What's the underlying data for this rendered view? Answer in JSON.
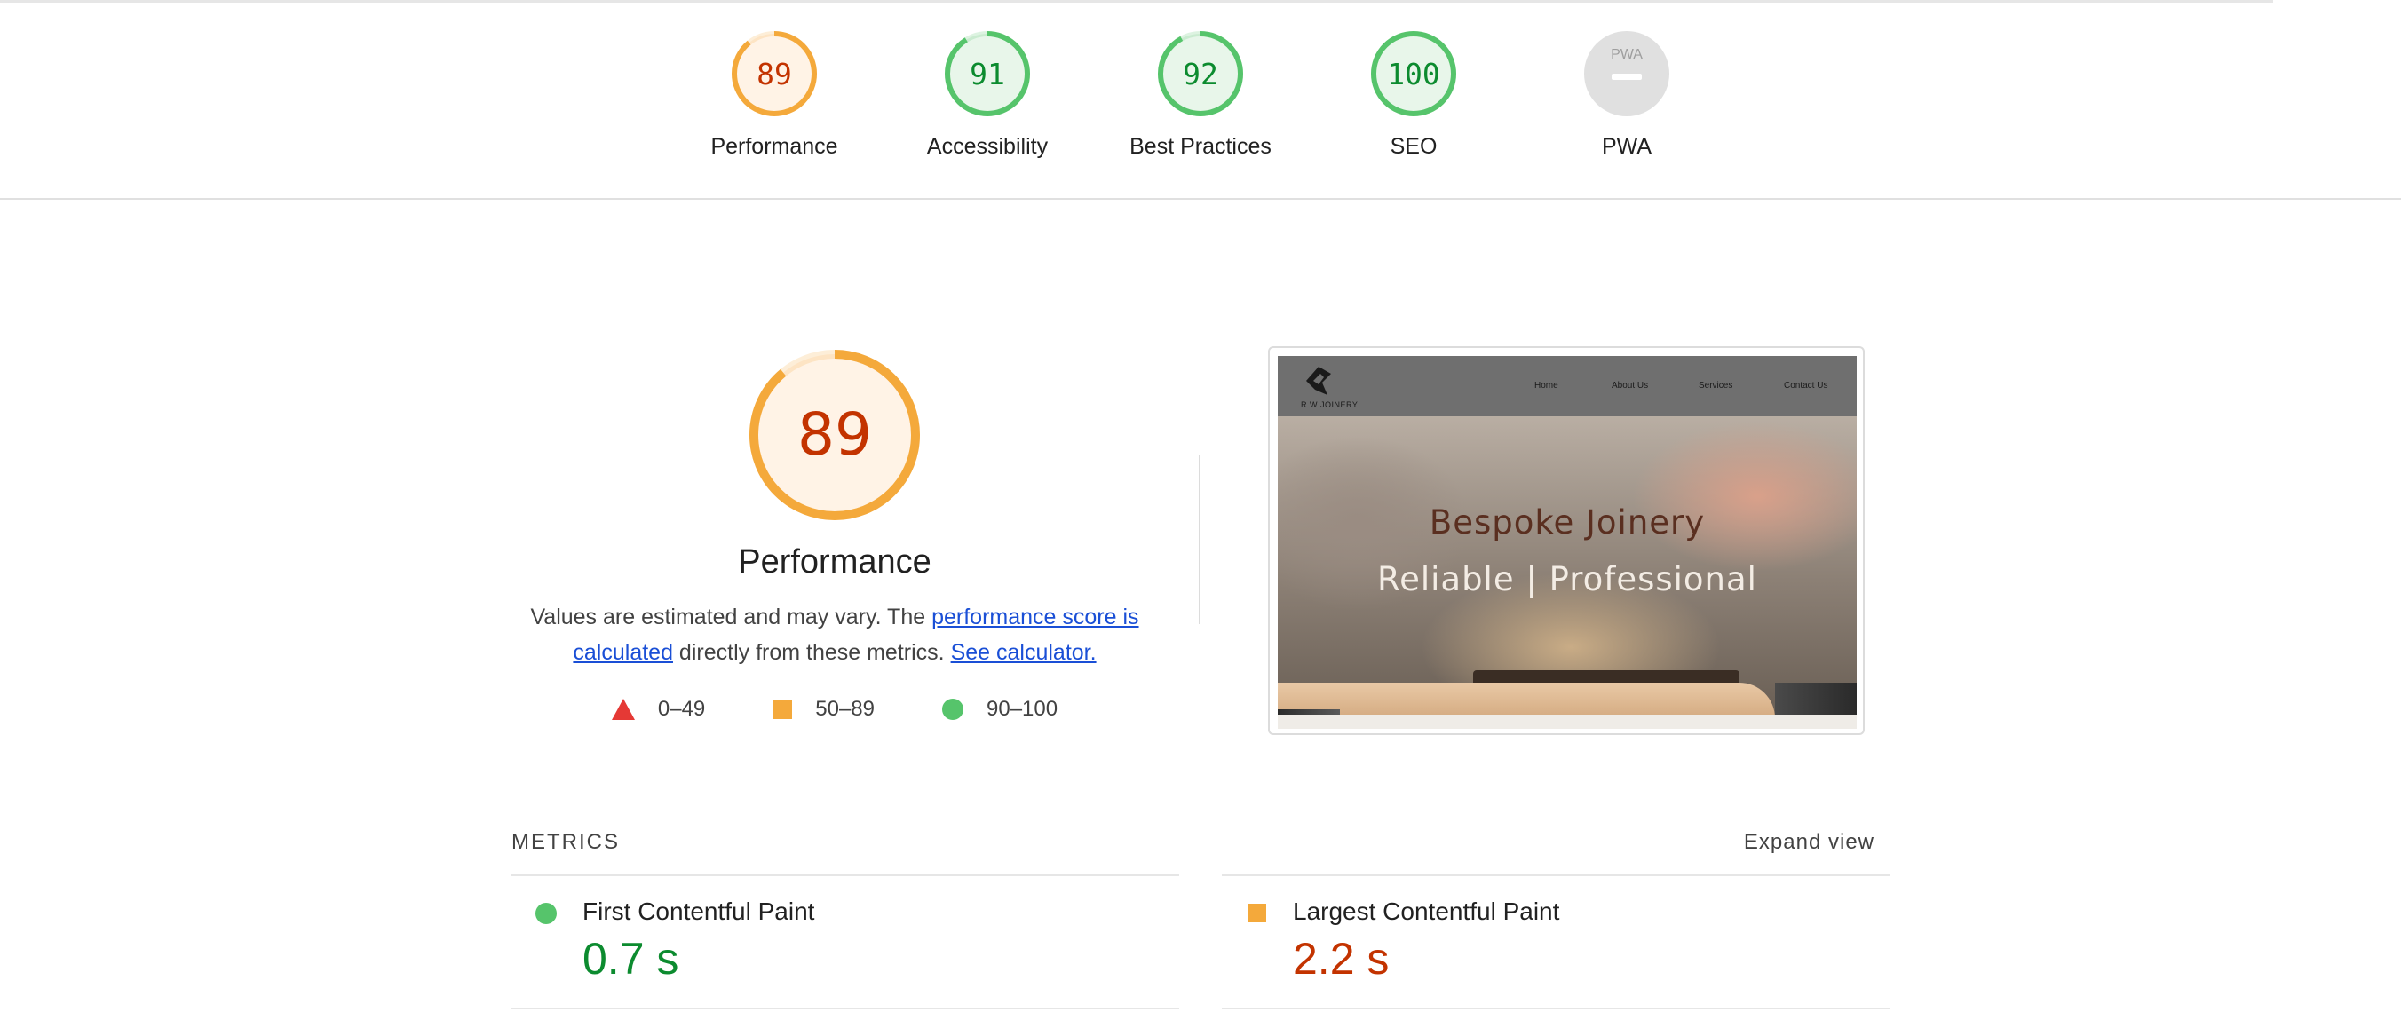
{
  "colors": {
    "pass": "#0c8b2f",
    "average": "#c33300",
    "fail": "#e53935",
    "pass_ring": "#56c46b",
    "average_ring": "#f4a93b",
    "pwa_ring": "#e0e0e0",
    "link": "#1a4fd6"
  },
  "summary": {
    "gauges": [
      {
        "score": "89",
        "label": "Performance",
        "rating": "average",
        "fraction": 0.89
      },
      {
        "score": "91",
        "label": "Accessibility",
        "rating": "pass",
        "fraction": 0.91
      },
      {
        "score": "92",
        "label": "Best Practices",
        "rating": "pass",
        "fraction": 0.92
      },
      {
        "score": "100",
        "label": "SEO",
        "rating": "pass",
        "fraction": 1.0
      },
      {
        "score": "",
        "label": "PWA",
        "rating": "na",
        "fraction": 0,
        "badge_text": "PWA"
      }
    ]
  },
  "performance": {
    "score": "89",
    "fraction": 0.89,
    "title": "Performance",
    "desc_prefix": "Values are estimated and may vary. The ",
    "desc_link": "performance score is calculated",
    "desc_middle": " directly from these metrics.",
    "calculator_link": "See calculator.",
    "legend": [
      {
        "shape": "triangle",
        "range": "0–49"
      },
      {
        "shape": "square",
        "range": "50–89"
      },
      {
        "shape": "circle",
        "range": "90–100"
      }
    ]
  },
  "screenshot": {
    "brand": "R W JOINERY",
    "menu": [
      "Home",
      "About Us",
      "Services",
      "Contact Us"
    ],
    "title_1": "Bespoke Joinery",
    "title_2": "Reliable | Professional"
  },
  "metrics": {
    "title": "METRICS",
    "expand_label": "Expand view",
    "items": [
      {
        "name": "First Contentful Paint",
        "value": "0.7 s",
        "rating": "pass"
      },
      {
        "name": "Largest Contentful Paint",
        "value": "2.2 s",
        "rating": "average"
      }
    ]
  }
}
